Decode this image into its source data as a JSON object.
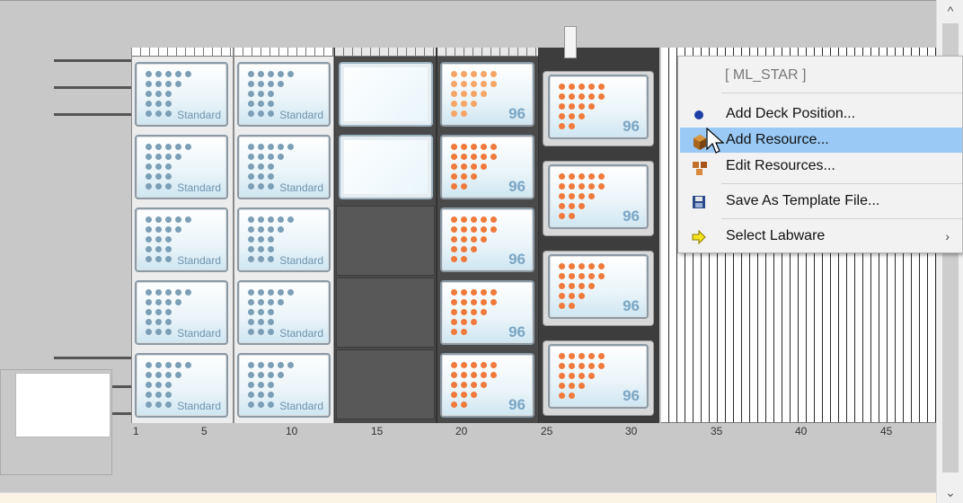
{
  "deck": {
    "plate_standard_label": "Standard",
    "plate_96_label": "96",
    "ruler_ticks": [
      "1",
      "5",
      "10",
      "15",
      "20",
      "25",
      "30",
      "35",
      "40",
      "45"
    ],
    "colors": {
      "standard_dots": "#7c9fb6",
      "orange_dots": "#f07a3b",
      "orange_light_dots": "#f5a566"
    }
  },
  "context_menu": {
    "header": "[ ML_STAR ]",
    "items": [
      {
        "label": "Add Deck Position...",
        "icon": "blue-circle-icon"
      },
      {
        "label": "Add Resource...",
        "icon": "cube-icon",
        "highlighted": true
      },
      {
        "label": "Edit Resources...",
        "icon": "cubes-icon"
      },
      {
        "label": "Save As Template File...",
        "icon": "floppy-disk-icon"
      },
      {
        "label": "Select Labware",
        "icon": "yellow-arrow-icon",
        "submenu": true
      }
    ]
  },
  "scrollbar": {
    "up_arrow": "^",
    "down_arrow": "v"
  }
}
